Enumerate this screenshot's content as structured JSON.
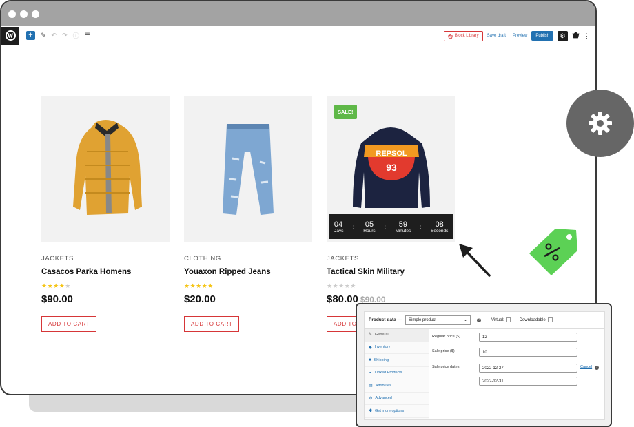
{
  "window": {
    "title_dots": [
      "●",
      "●",
      "●"
    ]
  },
  "toolbar": {
    "wp_logo": "W",
    "add_label": "+",
    "left_icons": [
      "pencil-icon",
      "undo-icon",
      "redo-icon",
      "info-icon",
      "list-view-icon"
    ],
    "block_library_label": "Block Library",
    "save_draft_label": "Save draft",
    "preview_label": "Preview",
    "publish_label": "Publish"
  },
  "products": [
    {
      "category": "JACKETS",
      "name": "Casacos Parka Homens",
      "rating": 4,
      "price": "$90.00",
      "old_price": "",
      "cart_label": "ADD TO CART",
      "image": "orange-puffer-jacket"
    },
    {
      "category": "CLOTHING",
      "name": "Youaxon Ripped Jeans",
      "rating": 5,
      "price": "$20.00",
      "old_price": "",
      "cart_label": "ADD TO CART",
      "image": "ripped-jeans"
    },
    {
      "category": "JACKETS",
      "name": "Tactical Skin Military",
      "rating": 0,
      "price": "$80.00",
      "old_price": "$90.00",
      "cart_label": "ADD TO",
      "image": "repsol-hoodie",
      "sale_badge": "SALE!",
      "countdown": [
        {
          "num": "04",
          "label": "Days"
        },
        {
          "num": "05",
          "label": "Hours"
        },
        {
          "num": "59",
          "label": "Minutes"
        },
        {
          "num": "08",
          "label": "Seconds"
        }
      ]
    }
  ],
  "hoodie_print": {
    "brand": "REPSOL",
    "number": "93"
  },
  "product_data": {
    "title": "Product data —",
    "type_value": "Simple product",
    "virtual_label": "Virtual:",
    "downloadable_label": "Downloadable:",
    "tabs": [
      "General",
      "Inventory",
      "Shipping",
      "Linked Products",
      "Attributes",
      "Advanced",
      "Get more options"
    ],
    "active_tab": "General",
    "regular_price_label": "Regular price ($)",
    "regular_price_value": "12",
    "sale_price_label": "Sale price ($)",
    "sale_price_value": "10",
    "sale_dates_label": "Sale price dates",
    "sale_date_from": "2022-12-27",
    "sale_date_to": "2022-12-31",
    "cancel_label": "Cancel"
  },
  "colors": {
    "accent": "#2271b1",
    "sale_green": "#5fb848",
    "cart_red": "#d63638",
    "star": "#f5c518",
    "tag_green": "#5cd155"
  }
}
